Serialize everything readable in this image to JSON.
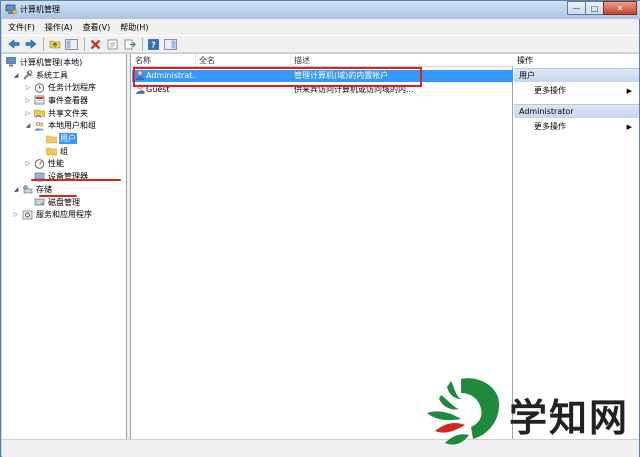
{
  "window": {
    "title": "计算机管理",
    "buttons": {
      "minimize": "—",
      "maximize": "□",
      "close": "✕"
    }
  },
  "menubar": {
    "items": [
      "文件(F)",
      "操作(A)",
      "查看(V)",
      "帮助(H)"
    ]
  },
  "toolbar": {
    "icons": [
      "back-arrow-icon",
      "forward-arrow-icon",
      "folder-up-icon",
      "console-tree-icon",
      "delete-icon",
      "properties-icon",
      "export-icon",
      "help-icon",
      "show-hide-pane-icon"
    ]
  },
  "tree": {
    "root": "计算机管理(本地)",
    "items": [
      {
        "label": "系统工具",
        "level": 1,
        "expander": "◢",
        "icon": "tools-icon"
      },
      {
        "label": "任务计划程序",
        "level": 2,
        "expander": "▷",
        "icon": "clock-icon"
      },
      {
        "label": "事件查看器",
        "level": 2,
        "expander": "▷",
        "icon": "event-viewer-icon"
      },
      {
        "label": "共享文件夹",
        "level": 2,
        "expander": "▷",
        "icon": "shared-folder-icon"
      },
      {
        "label": "本地用户和组",
        "level": 2,
        "expander": "◢",
        "icon": "users-group-icon"
      },
      {
        "label": "用户",
        "level": 3,
        "expander": "",
        "icon": "folder-icon",
        "selected": true
      },
      {
        "label": "组",
        "level": 3,
        "expander": "",
        "icon": "folder-icon"
      },
      {
        "label": "性能",
        "level": 2,
        "expander": "▷",
        "icon": "performance-icon"
      },
      {
        "label": "设备管理器",
        "level": 2,
        "expander": "",
        "icon": "device-manager-icon"
      },
      {
        "label": "存储",
        "level": 1,
        "expander": "◢",
        "icon": "storage-icon"
      },
      {
        "label": "磁盘管理",
        "level": 2,
        "expander": "",
        "icon": "disk-icon"
      },
      {
        "label": "服务和应用程序",
        "level": 1,
        "expander": "▷",
        "icon": "services-icon"
      }
    ]
  },
  "list": {
    "columns": [
      "名称",
      "全名",
      "描述"
    ],
    "rows": [
      {
        "name": "Administrat...",
        "fullname": "",
        "description": "管理计算机(域)的内置帐户",
        "selected": true
      },
      {
        "name": "Guest",
        "fullname": "",
        "description": "供来宾访问计算机或访问域的内..."
      }
    ]
  },
  "actions": {
    "header": "操作",
    "sections": [
      {
        "title": "用户",
        "items": [
          "更多操作"
        ]
      },
      {
        "title": "Administrator",
        "items": [
          "更多操作"
        ]
      }
    ]
  },
  "watermark": {
    "text": "学知网"
  },
  "colors": {
    "selection": "#3399ff",
    "highlight_box": "#e0201c",
    "action_section": "#c4d6ec",
    "logo_green": "#1f8a3b",
    "logo_red": "#d5281d"
  }
}
